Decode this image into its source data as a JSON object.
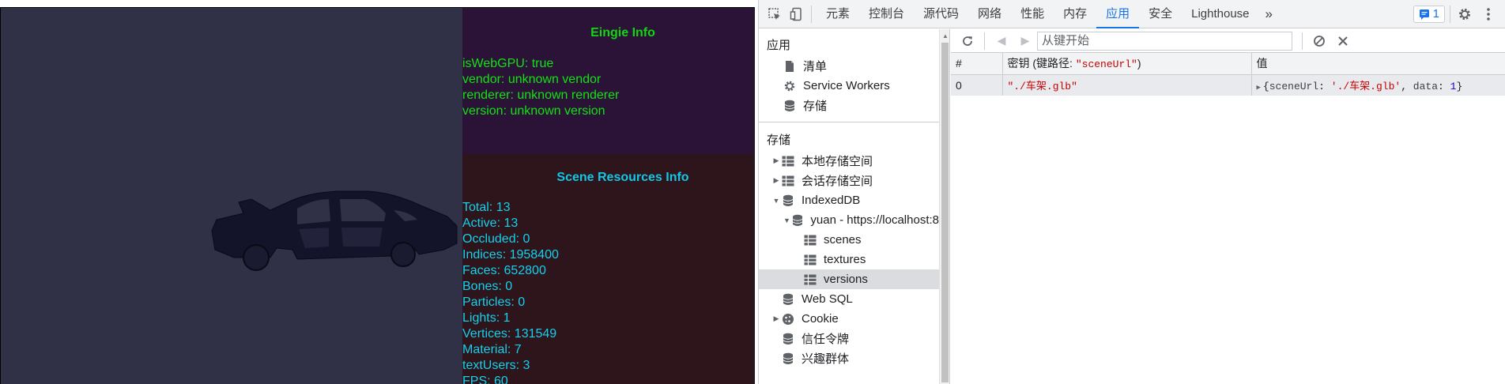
{
  "engine_info": {
    "title": "Eingie Info",
    "lines": [
      "isWebGPU: true",
      "vendor: unknown vendor",
      "renderer: unknown renderer",
      "version: unknown version"
    ]
  },
  "scene_info": {
    "title": "Scene Resources Info",
    "lines": [
      "Total: 13",
      "Active: 13",
      "Occluded: 0",
      "Indices: 1958400",
      "Faces: 652800",
      "Bones: 0",
      "Particles: 0",
      "Lights: 1",
      "Vertices: 131549",
      "Material: 7",
      "textUsers: 3",
      "FPS: 60"
    ]
  },
  "devtools": {
    "tabs": [
      "元素",
      "控制台",
      "源代码",
      "网络",
      "性能",
      "内存",
      "应用",
      "安全",
      "Lighthouse"
    ],
    "active_tab": "应用",
    "more_tabs": "»",
    "issues_count": "1",
    "icons": {
      "inspect": "inspect-element-icon",
      "device": "device-toolbar-icon",
      "settings": "gear-icon",
      "menu": "kebab-menu-icon"
    },
    "sidebar": {
      "app_section": "应用",
      "app_items": [
        {
          "label": "清单",
          "icon": "document-icon"
        },
        {
          "label": "Service Workers",
          "icon": "gear-icon"
        },
        {
          "label": "存储",
          "icon": "database-icon"
        }
      ],
      "storage_section": "存储",
      "storage_items": [
        {
          "label": "本地存储空间",
          "icon": "grid-icon",
          "expander": "▶",
          "indent": 0
        },
        {
          "label": "会话存储空间",
          "icon": "grid-icon",
          "expander": "▶",
          "indent": 0
        },
        {
          "label": "IndexedDB",
          "icon": "database-icon",
          "expander": "▼",
          "indent": 0
        },
        {
          "label": "yuan - https://localhost:8",
          "icon": "database-icon",
          "expander": "▼",
          "indent": 1
        },
        {
          "label": "scenes",
          "icon": "grid-icon",
          "expander": "",
          "indent": 2
        },
        {
          "label": "textures",
          "icon": "grid-icon",
          "expander": "",
          "indent": 2
        },
        {
          "label": "versions",
          "icon": "grid-icon",
          "expander": "",
          "indent": 2,
          "selected": true
        },
        {
          "label": "Web SQL",
          "icon": "database-icon",
          "expander": "",
          "indent": 0
        },
        {
          "label": "Cookie",
          "icon": "cookie-icon",
          "expander": "▶",
          "indent": 0
        },
        {
          "label": "信任令牌",
          "icon": "database-icon",
          "expander": "",
          "indent": 0
        },
        {
          "label": "兴趣群体",
          "icon": "database-icon",
          "expander": "",
          "indent": 0
        }
      ]
    },
    "toolbar": {
      "key_placeholder": "从键开始"
    },
    "table": {
      "headers": {
        "index": "#",
        "key_prefix": "密钥 (键路径: ",
        "key_path": "\"sceneUrl\"",
        "key_suffix": ")",
        "value": "值"
      },
      "rows": [
        {
          "index": "0",
          "key": "\"./车架.glb\"",
          "value": {
            "open": "{",
            "k1": "sceneUrl",
            "sep1": ": ",
            "v1": "'./车架.glb'",
            "comma": ", ",
            "k2": "data",
            "sep2": ": ",
            "v2": "1",
            "close": "}"
          }
        }
      ]
    }
  }
}
